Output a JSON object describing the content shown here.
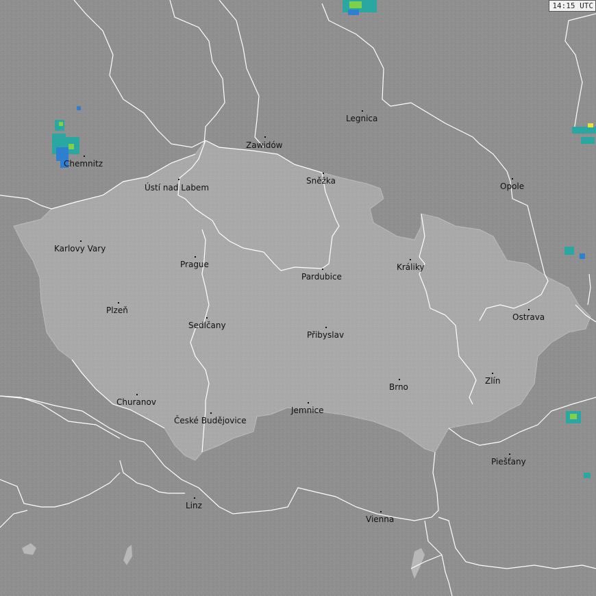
{
  "map": {
    "timestamp": "14:15 UTC",
    "cities": [
      {
        "id": "legnica",
        "name": "Legnica"
      },
      {
        "id": "zawidow",
        "name": "Zawidów"
      },
      {
        "id": "chemnitz",
        "name": "Chemnitz"
      },
      {
        "id": "usti",
        "name": "Ústí nad Labem"
      },
      {
        "id": "snezka",
        "name": "Sněžka"
      },
      {
        "id": "opole",
        "name": "Opole"
      },
      {
        "id": "karlovy-vary",
        "name": "Karlovy Vary"
      },
      {
        "id": "prague",
        "name": "Prague"
      },
      {
        "id": "kraliky",
        "name": "Králiky"
      },
      {
        "id": "pardubice",
        "name": "Pardubice"
      },
      {
        "id": "plzen",
        "name": "Plzeň"
      },
      {
        "id": "ostrava",
        "name": "Ostrava"
      },
      {
        "id": "sedlcany",
        "name": "Sedlčany"
      },
      {
        "id": "pribyslav",
        "name": "Přibyslav"
      },
      {
        "id": "zlin",
        "name": "Zlín"
      },
      {
        "id": "brno",
        "name": "Brno"
      },
      {
        "id": "churanov",
        "name": "Churanov"
      },
      {
        "id": "jemnice",
        "name": "Jemnice"
      },
      {
        "id": "ceske-budejovice",
        "name": "České Budějovice"
      },
      {
        "id": "piestany",
        "name": "Piešťany"
      },
      {
        "id": "linz",
        "name": "Linz"
      },
      {
        "id": "vienna",
        "name": "Vienna"
      }
    ],
    "colors": {
      "background": "#8f8f8f",
      "czech_region": "#a9a9a9",
      "border_line": "#ffffff",
      "label_text": "#101010",
      "radar_blue": "#2f7fd0",
      "radar_teal": "#2aa7a0",
      "radar_green": "#7fd04a",
      "radar_yellow": "#e8e040"
    }
  }
}
